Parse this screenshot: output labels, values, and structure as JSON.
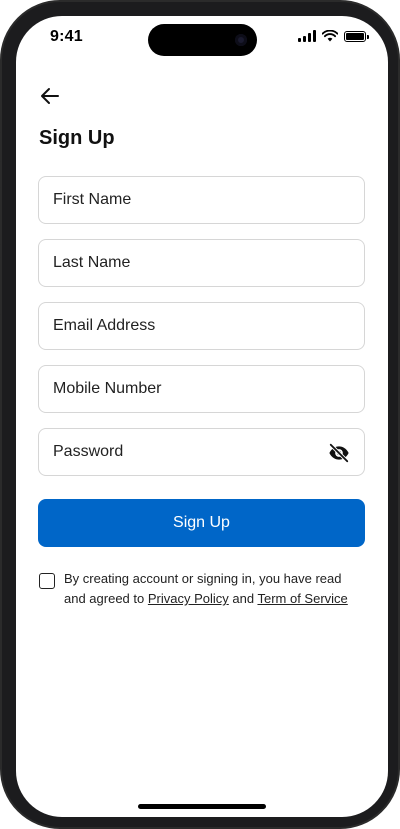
{
  "status_bar": {
    "time": "9:41"
  },
  "header": {
    "back_icon": "arrow-left-icon",
    "title": "Sign Up"
  },
  "form": {
    "first_name_placeholder": "First Name",
    "last_name_placeholder": "Last Name",
    "email_placeholder": "Email Address",
    "mobile_placeholder": "Mobile Number",
    "password_placeholder": "Password",
    "password_toggle_icon": "eye-off-icon",
    "submit_label": "Sign Up"
  },
  "terms": {
    "checked": false,
    "text_prefix": "By creating account or signing in, you have read and agreed to ",
    "privacy_link": "Privacy Policy",
    "conjunction": " and ",
    "terms_link": "Term of Service"
  },
  "colors": {
    "primary": "#0066c8",
    "border": "#d6d6d6",
    "text": "#222222"
  }
}
